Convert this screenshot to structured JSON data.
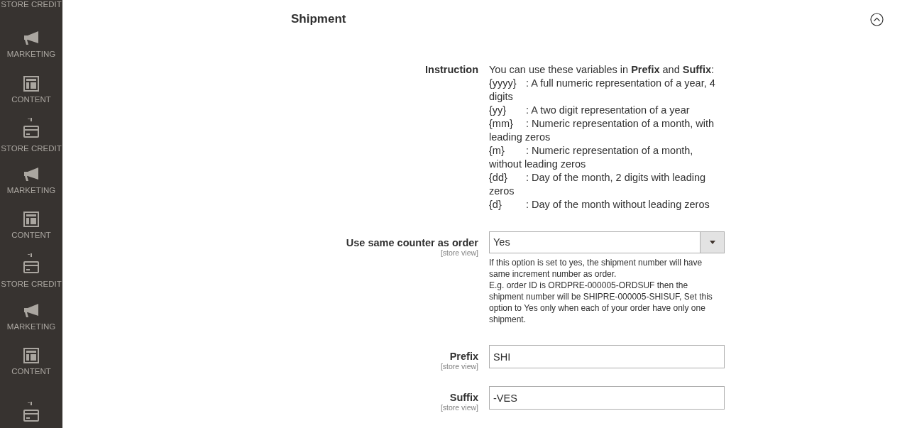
{
  "sidebar": {
    "items": [
      {
        "kind": "label_only",
        "label": "STORE CREDIT"
      },
      {
        "kind": "marketing",
        "label": "MARKETING"
      },
      {
        "kind": "content",
        "label": "CONTENT"
      },
      {
        "kind": "store_credit",
        "label": "STORE CREDIT"
      },
      {
        "kind": "marketing",
        "label": "MARKETING"
      },
      {
        "kind": "content",
        "label": "CONTENT"
      },
      {
        "kind": "store_credit",
        "label": "STORE CREDIT"
      },
      {
        "kind": "marketing",
        "label": "MARKETING"
      },
      {
        "kind": "content",
        "label": "CONTENT"
      },
      {
        "kind": "store_credit"
      }
    ]
  },
  "section": {
    "title": "Shipment",
    "expanded": true,
    "instruction": {
      "label": "Instruction",
      "intro": "You can use these variables in **Prefix** and **Suffix**:",
      "variables": [
        {
          "name": "{yyyy}",
          "description": ": A full numeric representation of a year, 4 digits"
        },
        {
          "name": "{yy}",
          "description": ": A two digit representation of a year"
        },
        {
          "name": "{mm}",
          "description": ": Numeric representation of a month, with leading zeros"
        },
        {
          "name": "{m}",
          "description": ": Numeric representation of a month, without leading zeros"
        },
        {
          "name": "{dd}",
          "description": ": Day of the month, 2 digits with leading zeros"
        },
        {
          "name": "{d}",
          "description": ": Day of the month without leading zeros"
        }
      ]
    },
    "fields": [
      {
        "kind": "select",
        "label": "Use same counter as order",
        "scope": "[store view]",
        "value": "Yes",
        "notes": [
          "If this option is set to yes, the shipment number will have same increment number as order.",
          "E.g. order ID is ORDPRE-000005-ORDSUF then the shipment number will be SHIPRE-000005-SHISUF, Set this option to Yes only when each of your order have only one shipment."
        ]
      },
      {
        "kind": "text",
        "label": "Prefix",
        "scope": "[store view]",
        "value": "SHI"
      },
      {
        "kind": "text",
        "label": "Suffix",
        "scope": "[store view]",
        "value": "-VES"
      }
    ]
  }
}
